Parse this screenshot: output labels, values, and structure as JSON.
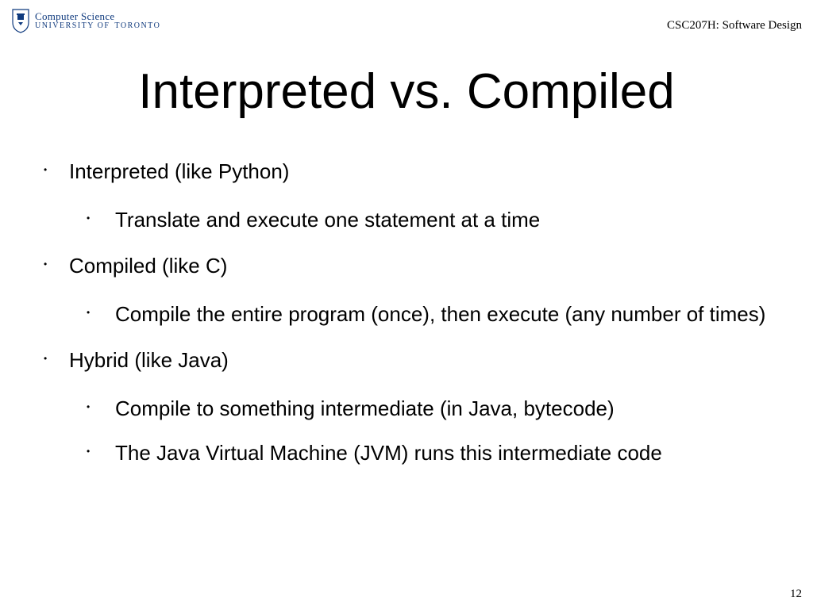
{
  "header": {
    "department": "Computer Science",
    "university": "UNIVERSITY OF",
    "city": "TORONTO",
    "course": "CSC207H: Software Design"
  },
  "title": "Interpreted vs. Compiled",
  "bullets": [
    {
      "text": "Interpreted (like Python)",
      "children": [
        {
          "text": "Translate and execute one statement at a time"
        }
      ]
    },
    {
      "text": "Compiled (like C)",
      "children": [
        {
          "text": "Compile the entire program (once), then execute (any number of times)"
        }
      ]
    },
    {
      "text": "Hybrid (like Java)",
      "children": [
        {
          "text": "Compile to something intermediate (in Java, bytecode)"
        },
        {
          "text": "The Java Virtual Machine (JVM) runs this intermediate code"
        }
      ]
    }
  ],
  "page_number": "12"
}
